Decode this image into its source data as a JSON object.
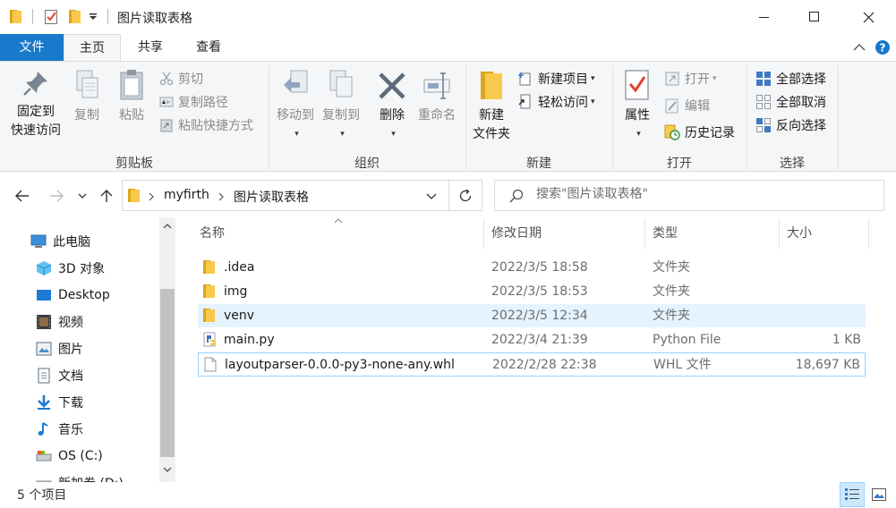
{
  "window": {
    "title": "图片读取表格"
  },
  "ribbon_tabs": {
    "file": "文件",
    "home": "主页",
    "share": "共享",
    "view": "查看"
  },
  "ribbon": {
    "clipboard": {
      "label": "剪贴板",
      "pin_line1": "固定到",
      "pin_line2": "快速访问",
      "copy": "复制",
      "paste": "粘贴",
      "cut": "剪切",
      "copy_path": "复制路径",
      "paste_shortcut": "粘贴快捷方式"
    },
    "organize": {
      "label": "组织",
      "move_to": "移动到",
      "copy_to": "复制到",
      "delete": "删除",
      "rename": "重命名"
    },
    "new": {
      "label": "新建",
      "new_folder_line1": "新建",
      "new_folder_line2": "文件夹",
      "new_item": "新建项目",
      "easy_access": "轻松访问"
    },
    "open": {
      "label": "打开",
      "properties": "属性",
      "open": "打开",
      "edit": "编辑",
      "history": "历史记录"
    },
    "select": {
      "label": "选择",
      "select_all": "全部选择",
      "select_none": "全部取消",
      "invert": "反向选择"
    }
  },
  "address": {
    "breadcrumb": [
      "myfirth",
      "图片读取表格"
    ],
    "search_placeholder": "搜索\"图片读取表格\""
  },
  "nav_pane": {
    "items": [
      {
        "label": "此电脑",
        "icon": "pc-icon"
      },
      {
        "label": "3D 对象",
        "icon": "3d-objects-icon"
      },
      {
        "label": "Desktop",
        "icon": "desktop-icon"
      },
      {
        "label": "视频",
        "icon": "video-icon"
      },
      {
        "label": "图片",
        "icon": "pictures-icon"
      },
      {
        "label": "文档",
        "icon": "documents-icon"
      },
      {
        "label": "下载",
        "icon": "downloads-icon"
      },
      {
        "label": "音乐",
        "icon": "music-icon"
      },
      {
        "label": "OS (C:)",
        "icon": "drive-icon"
      },
      {
        "label": "新加卷 (D:)",
        "icon": "drive-icon"
      }
    ]
  },
  "file_list": {
    "columns": [
      "名称",
      "修改日期",
      "类型",
      "大小"
    ],
    "rows": [
      {
        "name": ".idea",
        "date": "2022/3/5 18:58",
        "type": "文件夹",
        "size": "",
        "icon": "folder-icon"
      },
      {
        "name": "img",
        "date": "2022/3/5 18:53",
        "type": "文件夹",
        "size": "",
        "icon": "folder-icon"
      },
      {
        "name": "venv",
        "date": "2022/3/5 12:34",
        "type": "文件夹",
        "size": "",
        "icon": "folder-icon"
      },
      {
        "name": "main.py",
        "date": "2022/3/4 21:39",
        "type": "Python File",
        "size": "1 KB",
        "icon": "python-file-icon"
      },
      {
        "name": "layoutparser-0.0.0-py3-none-any.whl",
        "date": "2022/2/28 22:38",
        "type": "WHL 文件",
        "size": "18,697 KB",
        "icon": "file-icon"
      }
    ]
  },
  "status_bar": {
    "count": "5 个项目"
  },
  "colors": {
    "accent": "#1979ca",
    "folder": "#f8c94a",
    "hover": "#e5f3ff",
    "selected_border": "#99d1ff"
  }
}
